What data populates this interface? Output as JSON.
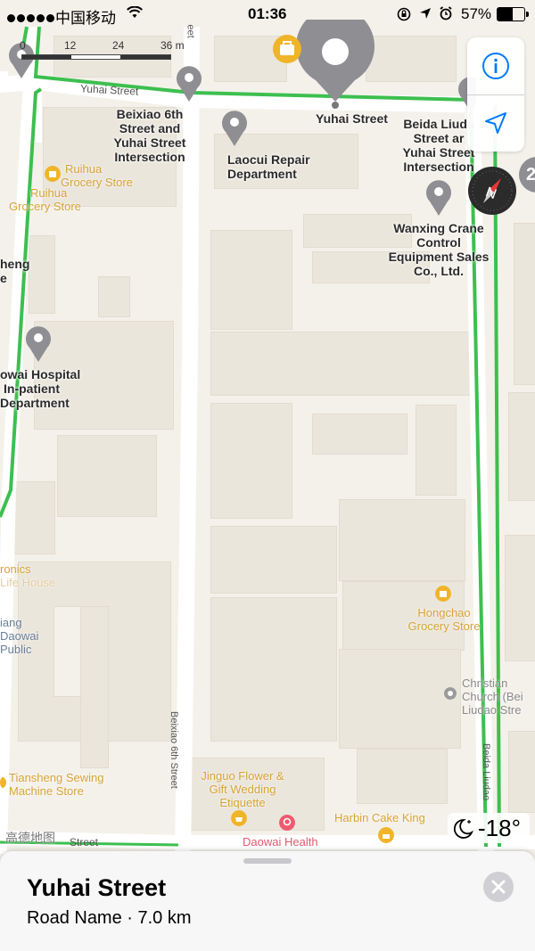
{
  "status_bar": {
    "carrier": "中国移动",
    "time": "01:36",
    "battery": "57%"
  },
  "map": {
    "scale_labels": [
      "0",
      "12",
      "24",
      "36 m"
    ],
    "street_labels": {
      "yuhai_top": "Yuhai Street",
      "beixiao_6th": "Beixiao 6th Street",
      "beida_liudao": "Beida Liudao",
      "yuhai_bottom": "Street",
      "eet_top": "eet"
    },
    "places": {
      "yuhai_street_selected": "Yuhai Street",
      "beixiao_intersection": [
        "Beixiao 6th",
        "Street and",
        "Yuhai Street",
        "Intersection"
      ],
      "laocui": [
        "Laocui Repair",
        "Department"
      ],
      "beida_intersection": [
        "Beida Liuda",
        "Street ar",
        "Yuhai Street",
        "Intersection"
      ],
      "wanxing": [
        "Wanxing Crane",
        "Control",
        "Equipment Sales",
        "Co., Ltd."
      ],
      "daowai_hospital": [
        "owai Hospital",
        "In-patient",
        "Department"
      ],
      "heng": [
        "heng",
        "e"
      ]
    },
    "pois": {
      "ruihua_1": [
        "Ruihua",
        "Grocery Store"
      ],
      "ruihua_2": [
        "Ruihua",
        "Grocery Store"
      ],
      "ronics": [
        "ronics",
        "Life House"
      ],
      "iang_daowai": [
        "iang",
        "Daowai",
        "Public"
      ],
      "hongchao": [
        "Hongchao",
        "Grocery Store"
      ],
      "christian": [
        "Christian",
        "Church (Bei",
        "Liudao Stre"
      ],
      "tiansheng": [
        "Tiansheng Sewing",
        "Machine Store"
      ],
      "jinguo": [
        "Jinguo Flower &",
        "Gift Wedding",
        "Etiquette"
      ],
      "harbin_cake": "Harbin Cake King",
      "daowai_health": "Daowai Health"
    },
    "logo": "高德地图",
    "badge_number": "2"
  },
  "weather": {
    "temperature": "-18°"
  },
  "sheet": {
    "title": "Yuhai Street",
    "subtitle": "Road Name · 7.0 km"
  },
  "colors": {
    "route": "#3dbf4f",
    "poi": "#d7a437",
    "pin": "#8e8e93",
    "ios_blue": "#007aff"
  }
}
